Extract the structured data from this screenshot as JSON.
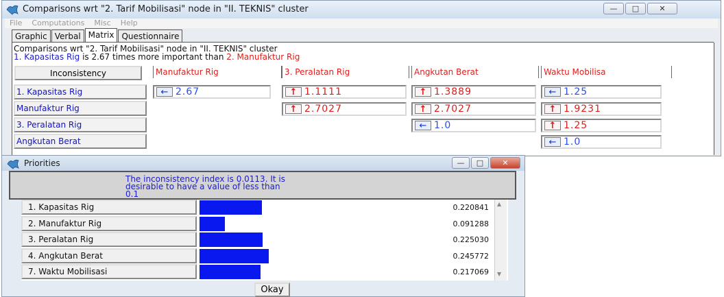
{
  "main_window": {
    "title": "Comparisons wrt \"2. Tarif Mobilisasi\" node in \"II. TEKNIS\" cluster",
    "controls": {
      "minimize": "—",
      "maximize": "□",
      "close": "✕"
    }
  },
  "menu": [
    "File",
    "Computations",
    "Misc",
    "Help"
  ],
  "tabs": [
    {
      "label": "Graphic",
      "active": false
    },
    {
      "label": "Verbal",
      "active": false
    },
    {
      "label": "Matrix",
      "active": true
    },
    {
      "label": "Questionnaire",
      "active": false
    }
  ],
  "info": {
    "line1": "Comparisons wrt \"2. Tarif Mobilisasi\" node in \"II. TEKNIS\" cluster",
    "line2_a": "1. Kapasitas Rig",
    "line2_b": " is 2.67 times more important than ",
    "line2_c": "2. Manufaktur Rig"
  },
  "matrix": {
    "inconsistency_button": "Inconsistency",
    "columns": [
      "Manufaktur Rig",
      "3. Peralatan Rig",
      "Angkutan Berat",
      "Waktu Mobilisa"
    ],
    "rows": [
      "1. Kapasitas Rig",
      "Manufaktur Rig",
      "3. Peralatan Rig",
      "Angkutan Berat"
    ],
    "cells": [
      [
        {
          "arrow": "left",
          "value": "2.67",
          "color": "#2a4ef0"
        },
        {
          "arrow": "up",
          "value": "1.1111",
          "color": "#e01c1c"
        },
        {
          "arrow": "up",
          "value": "1.3889",
          "color": "#e01c1c"
        },
        {
          "arrow": "left",
          "value": "1.25",
          "color": "#2a4ef0"
        }
      ],
      [
        null,
        {
          "arrow": "up",
          "value": "2.7027",
          "color": "#e01c1c"
        },
        {
          "arrow": "up",
          "value": "2.7027",
          "color": "#e01c1c"
        },
        {
          "arrow": "up",
          "value": "1.9231",
          "color": "#e01c1c"
        }
      ],
      [
        null,
        null,
        {
          "arrow": "left",
          "value": "1.0",
          "color": "#2a4ef0"
        },
        {
          "arrow": "up",
          "value": "1.25",
          "color": "#e01c1c"
        }
      ],
      [
        null,
        null,
        null,
        {
          "arrow": "left",
          "value": "1.0",
          "color": "#2a4ef0"
        }
      ]
    ]
  },
  "priorities_window": {
    "title": "Priorities",
    "message_line1": "The inconsistency index is 0.0113.  It is",
    "message_line2": "desirable to have a value of less than",
    "message_line3": "0.1",
    "items": [
      {
        "label": "1. Kapasitas Rig",
        "value": "0.220841",
        "weight": 0.220841
      },
      {
        "label": "2. Manufaktur Rig",
        "value": "0.091288",
        "weight": 0.091288
      },
      {
        "label": "3. Peralatan Rig",
        "value": "0.225030",
        "weight": 0.22503
      },
      {
        "label": "4. Angkutan Berat",
        "value": "0.245772",
        "weight": 0.245772
      },
      {
        "label": "7. Waktu Mobilisasi",
        "value": "0.217069",
        "weight": 0.217069
      }
    ],
    "okay_label": "Okay",
    "bar_color": "#0a18f0"
  }
}
